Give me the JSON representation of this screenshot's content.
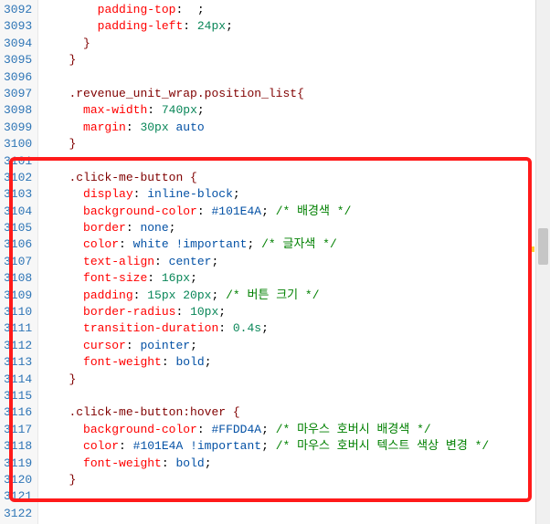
{
  "gutter_start": 3092,
  "gutter_end": 3122,
  "lines": [
    [
      [
        "ws",
        "        "
      ],
      [
        "prop",
        "padding-top"
      ],
      [
        "punct",
        ": "
      ],
      [
        "val",
        " "
      ],
      [
        "punct",
        ";"
      ]
    ],
    [
      [
        "ws",
        "        "
      ],
      [
        "prop",
        "padding-left"
      ],
      [
        "punct",
        ": "
      ],
      [
        "num",
        "24px"
      ],
      [
        "punct",
        ";"
      ]
    ],
    [
      [
        "ws",
        "      "
      ],
      [
        "sel",
        "}"
      ]
    ],
    [
      [
        "ws",
        "    "
      ],
      [
        "sel",
        "}"
      ]
    ],
    [],
    [
      [
        "ws",
        "    "
      ],
      [
        "sel",
        ".revenue_unit_wrap.position_list{"
      ]
    ],
    [
      [
        "ws",
        "      "
      ],
      [
        "prop",
        "max-width"
      ],
      [
        "punct",
        ": "
      ],
      [
        "num",
        "740px"
      ],
      [
        "punct",
        ";"
      ]
    ],
    [
      [
        "ws",
        "      "
      ],
      [
        "prop",
        "margin"
      ],
      [
        "punct",
        ": "
      ],
      [
        "num",
        "30px"
      ],
      [
        "val",
        " auto"
      ]
    ],
    [
      [
        "ws",
        "    "
      ],
      [
        "sel",
        "}"
      ]
    ],
    [],
    [
      [
        "ws",
        "    "
      ],
      [
        "sel",
        ".click-me-button {"
      ]
    ],
    [
      [
        "ws",
        "      "
      ],
      [
        "prop",
        "display"
      ],
      [
        "punct",
        ": "
      ],
      [
        "val",
        "inline-block"
      ],
      [
        "punct",
        ";"
      ]
    ],
    [
      [
        "ws",
        "      "
      ],
      [
        "prop",
        "background-color"
      ],
      [
        "punct",
        ": "
      ],
      [
        "val",
        "#101E4A"
      ],
      [
        "punct",
        "; "
      ],
      [
        "cmt",
        "/* 배경색 */"
      ]
    ],
    [
      [
        "ws",
        "      "
      ],
      [
        "prop",
        "border"
      ],
      [
        "punct",
        ": "
      ],
      [
        "val",
        "none"
      ],
      [
        "punct",
        ";"
      ]
    ],
    [
      [
        "ws",
        "      "
      ],
      [
        "prop",
        "color"
      ],
      [
        "punct",
        ": "
      ],
      [
        "val",
        "white "
      ],
      [
        "imp",
        "!important"
      ],
      [
        "punct",
        "; "
      ],
      [
        "cmt",
        "/* 글자색 */"
      ]
    ],
    [
      [
        "ws",
        "      "
      ],
      [
        "prop",
        "text-align"
      ],
      [
        "punct",
        ": "
      ],
      [
        "val",
        "center"
      ],
      [
        "punct",
        ";"
      ]
    ],
    [
      [
        "ws",
        "      "
      ],
      [
        "prop",
        "font-size"
      ],
      [
        "punct",
        ": "
      ],
      [
        "num",
        "16px"
      ],
      [
        "punct",
        ";"
      ]
    ],
    [
      [
        "ws",
        "      "
      ],
      [
        "prop",
        "padding"
      ],
      [
        "punct",
        ": "
      ],
      [
        "num",
        "15px 20px"
      ],
      [
        "punct",
        "; "
      ],
      [
        "cmt",
        "/* 버튼 크기 */"
      ]
    ],
    [
      [
        "ws",
        "      "
      ],
      [
        "prop",
        "border-radius"
      ],
      [
        "punct",
        ": "
      ],
      [
        "num",
        "10px"
      ],
      [
        "punct",
        ";"
      ]
    ],
    [
      [
        "ws",
        "      "
      ],
      [
        "prop",
        "transition-duration"
      ],
      [
        "punct",
        ": "
      ],
      [
        "num",
        "0.4s"
      ],
      [
        "punct",
        ";"
      ]
    ],
    [
      [
        "ws",
        "      "
      ],
      [
        "prop",
        "cursor"
      ],
      [
        "punct",
        ": "
      ],
      [
        "val",
        "pointer"
      ],
      [
        "punct",
        ";"
      ]
    ],
    [
      [
        "ws",
        "      "
      ],
      [
        "prop",
        "font-weight"
      ],
      [
        "punct",
        ": "
      ],
      [
        "val",
        "bold"
      ],
      [
        "punct",
        ";"
      ]
    ],
    [
      [
        "ws",
        "    "
      ],
      [
        "sel",
        "}"
      ]
    ],
    [],
    [
      [
        "ws",
        "    "
      ],
      [
        "sel",
        ".click-me-button:hover {"
      ]
    ],
    [
      [
        "ws",
        "      "
      ],
      [
        "prop",
        "background-color"
      ],
      [
        "punct",
        ": "
      ],
      [
        "val",
        "#FFDD4A"
      ],
      [
        "punct",
        "; "
      ],
      [
        "cmt",
        "/* 마우스 호버시 배경색 */"
      ]
    ],
    [
      [
        "ws",
        "      "
      ],
      [
        "prop",
        "color"
      ],
      [
        "punct",
        ": "
      ],
      [
        "val",
        "#101E4A "
      ],
      [
        "imp",
        "!important"
      ],
      [
        "punct",
        "; "
      ],
      [
        "cmt",
        "/* 마우스 호버시 텍스트 색상 변경 */"
      ]
    ],
    [
      [
        "ws",
        "      "
      ],
      [
        "prop",
        "font-weight"
      ],
      [
        "punct",
        ": "
      ],
      [
        "val",
        "bold"
      ],
      [
        "punct",
        ";"
      ]
    ],
    [
      [
        "ws",
        "    "
      ],
      [
        "sel",
        "}"
      ]
    ],
    [],
    []
  ]
}
